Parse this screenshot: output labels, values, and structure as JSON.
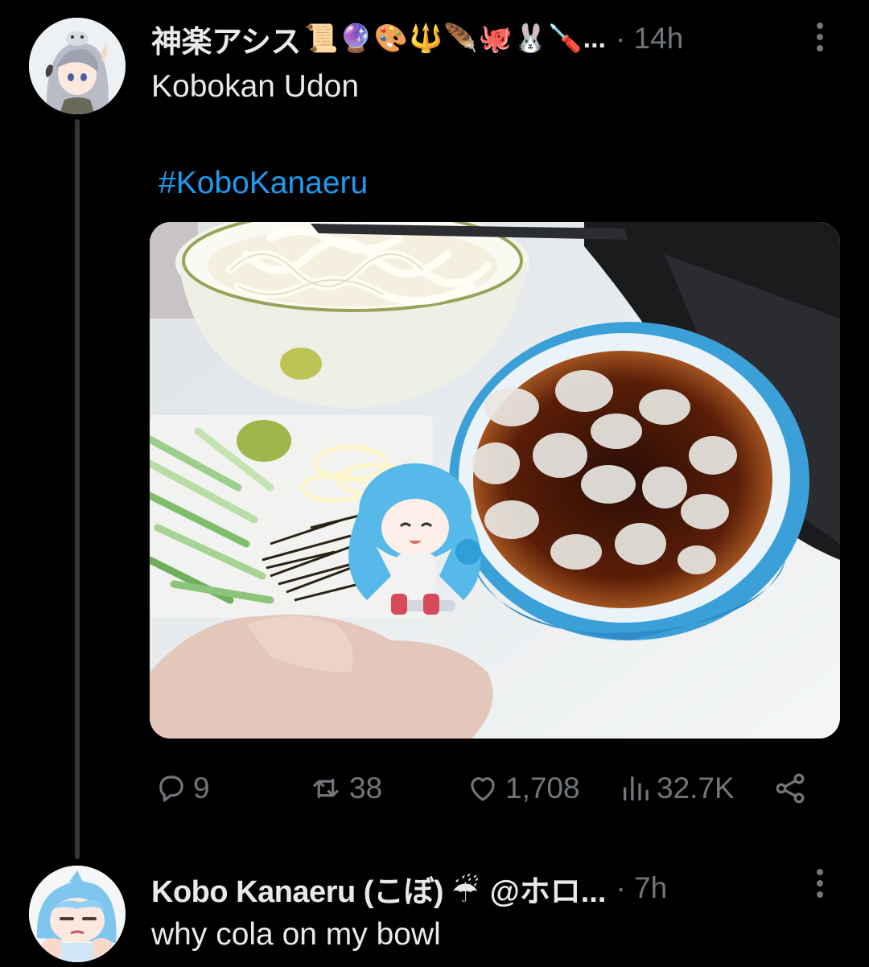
{
  "post": {
    "author_name": "神楽アシス",
    "author_emojis": "📜🔮🎨🔱🪶🐙🐰🪛",
    "name_ellipsis": "...",
    "time": "· 14h",
    "text": "Kobokan Udon",
    "hashtag": "#KoboKanaeru",
    "media_icon": "photo-udon-iced-cola-bowl",
    "stats": {
      "replies": "9",
      "reposts": "38",
      "likes": "1,708",
      "views": "32.7K"
    }
  },
  "reply": {
    "author_name": "Kobo Kanaeru (こぼ) ☔",
    "handle": "@ホロ...",
    "time": "· 7h",
    "text": "why cola on my bowl"
  },
  "colors": {
    "background": "#000000",
    "text": "#e7e9ea",
    "muted": "#71767b",
    "link": "#1d9bf0"
  }
}
